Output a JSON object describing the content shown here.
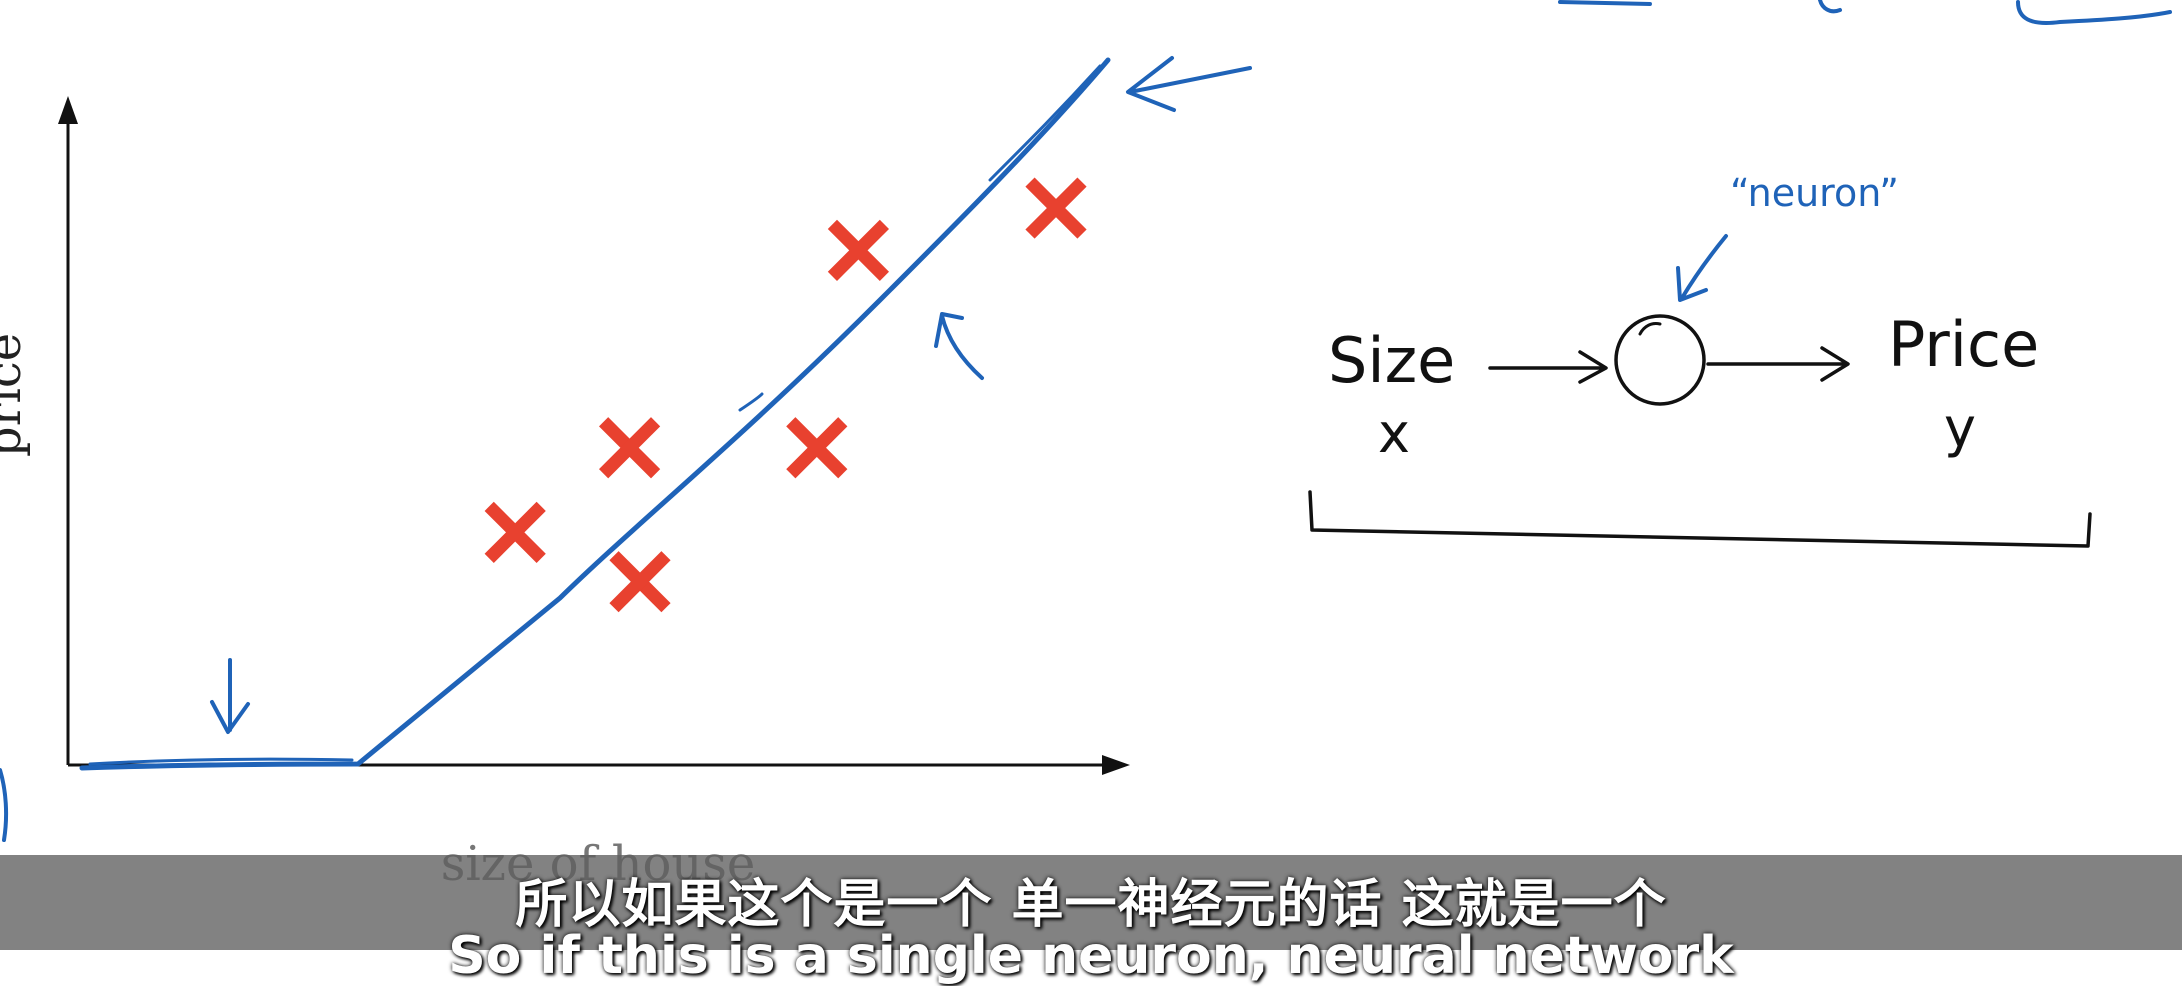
{
  "plot": {
    "ylabel": "price",
    "xlabel": "size of house"
  },
  "chart_data": {
    "type": "scatter",
    "xlabel": "size of house",
    "ylabel": "price",
    "points": [
      {
        "x": 0.43,
        "y": 0.33
      },
      {
        "x": 0.55,
        "y": 0.26
      },
      {
        "x": 0.54,
        "y": 0.45
      },
      {
        "x": 0.72,
        "y": 0.45
      },
      {
        "x": 0.76,
        "y": 0.73
      },
      {
        "x": 0.95,
        "y": 0.79
      }
    ],
    "fit_line": [
      {
        "x": 0.02,
        "y": 0.0
      },
      {
        "x": 0.28,
        "y": 0.0
      },
      {
        "x": 1.0,
        "y": 1.0
      }
    ]
  },
  "diagram": {
    "input_label": "Size",
    "input_var": "x",
    "neuron_label": "“neuron”",
    "output_label": "Price",
    "output_var": "y"
  },
  "subtitles": {
    "chinese": "所以如果这个是一个 单一神经元的话 这就是一个",
    "english": "So if this is a single neuron, neural network"
  },
  "colors": {
    "ink_blue": "#1f63b8",
    "cross_red": "#e8412f",
    "axis": "#111111",
    "subtitle_bar": "#5f5f5f"
  }
}
